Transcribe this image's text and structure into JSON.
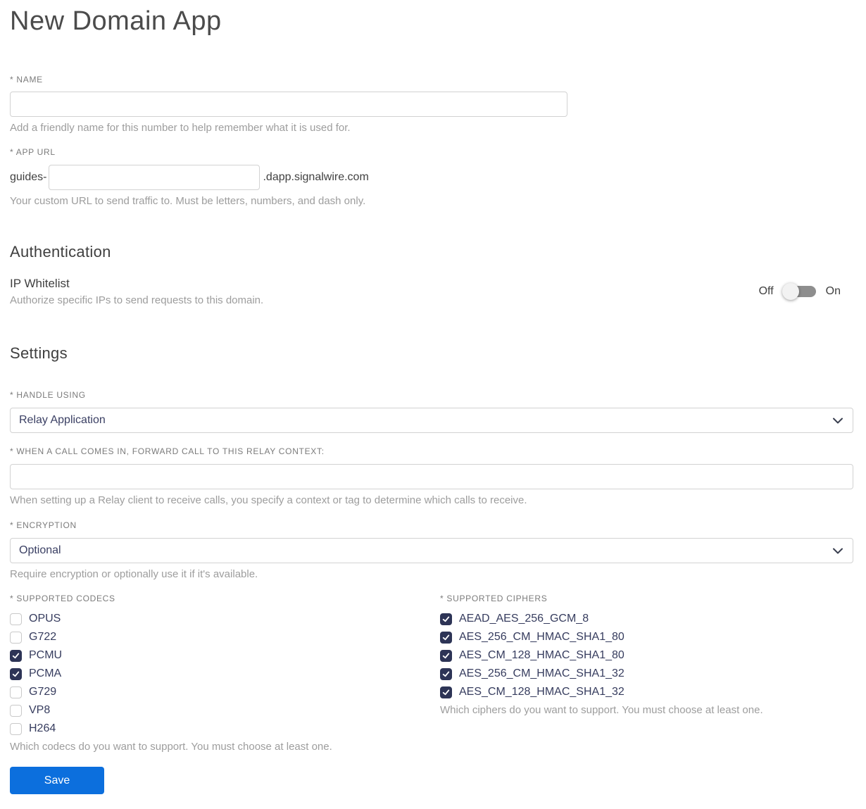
{
  "page": {
    "title": "New Domain App"
  },
  "name_field": {
    "label": "* NAME",
    "value": "",
    "helper": "Add a friendly name for this number to help remember what it is used for."
  },
  "app_url_field": {
    "label": "* APP URL",
    "prefix": "guides-",
    "value": "",
    "suffix": ".dapp.signalwire.com",
    "helper": "Your custom URL to send traffic to. Must be letters, numbers, and dash only."
  },
  "authentication": {
    "heading": "Authentication",
    "ip_whitelist": {
      "label": "IP Whitelist",
      "helper": "Authorize specific IPs to send requests to this domain.",
      "off_label": "Off",
      "on_label": "On",
      "state": "off"
    }
  },
  "settings": {
    "heading": "Settings",
    "handle_using": {
      "label": "* HANDLE USING",
      "selected": "Relay Application"
    },
    "relay_context": {
      "label": "* WHEN A CALL COMES IN, FORWARD CALL TO THIS RELAY CONTEXT:",
      "value": "",
      "helper": "When setting up a Relay client to receive calls, you specify a context or tag to determine which calls to receive."
    },
    "encryption": {
      "label": "* ENCRYPTION",
      "selected": "Optional",
      "helper": "Require encryption or optionally use it if it's available."
    },
    "codecs": {
      "label": "* SUPPORTED CODECS",
      "helper": "Which codecs do you want to support. You must choose at least one.",
      "options": [
        {
          "label": "OPUS",
          "checked": false
        },
        {
          "label": "G722",
          "checked": false
        },
        {
          "label": "PCMU",
          "checked": true
        },
        {
          "label": "PCMA",
          "checked": true
        },
        {
          "label": "G729",
          "checked": false
        },
        {
          "label": "VP8",
          "checked": false
        },
        {
          "label": "H264",
          "checked": false
        }
      ]
    },
    "ciphers": {
      "label": "* SUPPORTED CIPHERS",
      "helper": "Which ciphers do you want to support. You must choose at least one.",
      "options": [
        {
          "label": "AEAD_AES_256_GCM_8",
          "checked": true
        },
        {
          "label": "AES_256_CM_HMAC_SHA1_80",
          "checked": true
        },
        {
          "label": "AES_CM_128_HMAC_SHA1_80",
          "checked": true
        },
        {
          "label": "AES_256_CM_HMAC_SHA1_32",
          "checked": true
        },
        {
          "label": "AES_CM_128_HMAC_SHA1_32",
          "checked": true
        }
      ]
    }
  },
  "save_button": {
    "label": "Save"
  },
  "colors": {
    "accent_blue": "#0c6fdd",
    "checkbox_checked": "#2d3456",
    "toggle_track": "#8e8e8e",
    "toggle_knob": "#f2f2f2"
  }
}
